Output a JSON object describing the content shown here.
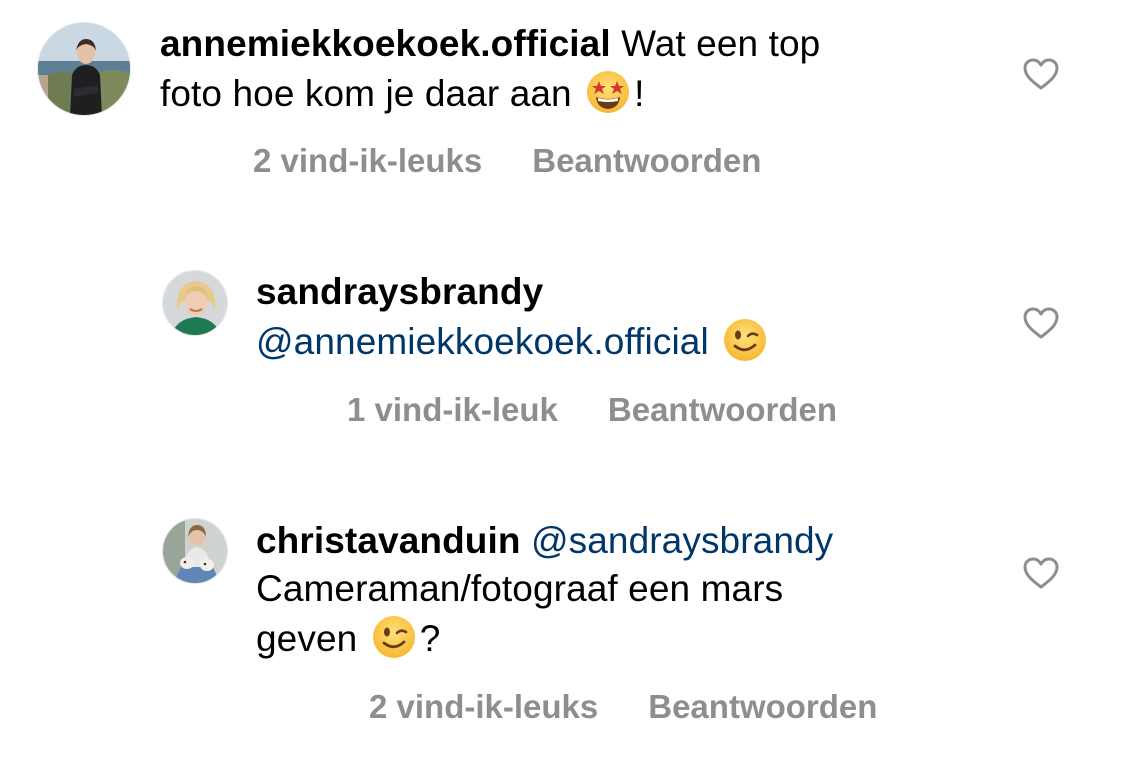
{
  "comments": [
    {
      "username": "annemiekkoekoek.official",
      "text_line1": " Wat een top",
      "text_line2_before": "foto hoe kom je daar aan ",
      "emoji": "star-struck-emoji",
      "text_line2_after": "!",
      "likes": "2 vind-ik-leuks",
      "reply": "Beantwoorden"
    },
    {
      "username": "sandraysbrandy",
      "mention": "@annemiekkoekoek.official",
      "emoji": "winking-face-emoji",
      "likes": "1 vind-ik-leuk",
      "reply": "Beantwoorden"
    },
    {
      "username": "christavanduin",
      "mention": " @sandraysbrandy",
      "text_line2": "Cameraman/fotograaf een mars",
      "text_line3_before": "geven ",
      "emoji": "winking-face-emoji",
      "text_line3_after": "?",
      "likes": "2 vind-ik-leuks",
      "reply": "Beantwoorden"
    }
  ],
  "colors": {
    "mention": "#00376b",
    "meta": "#8e8e8e",
    "heart_outline": "#8e8e8e"
  }
}
